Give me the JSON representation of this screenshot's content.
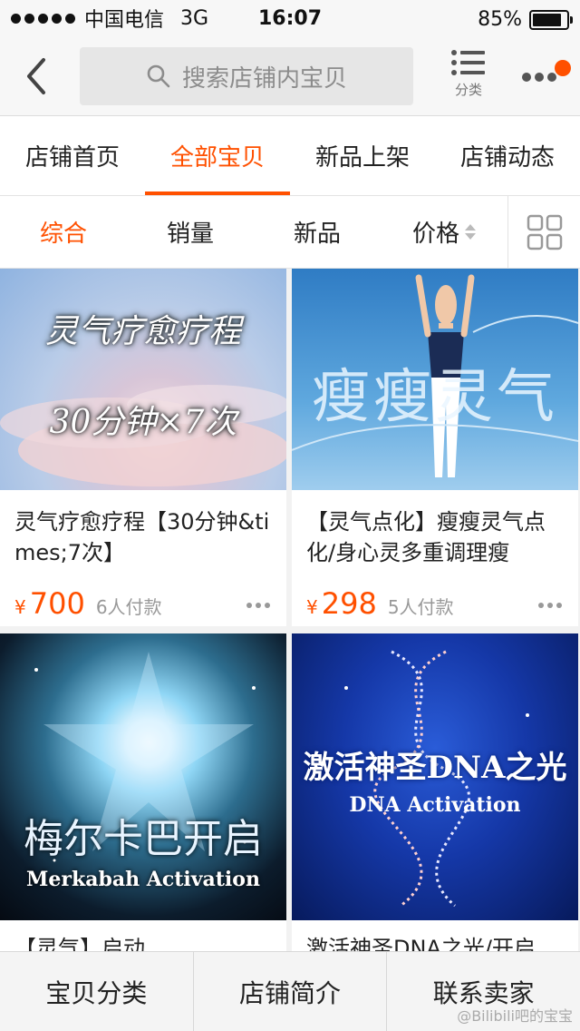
{
  "status_bar": {
    "carrier": "中国电信",
    "network": "3G",
    "time": "16:07",
    "battery_text": "85%",
    "battery_level": 0.85
  },
  "nav": {
    "back_icon": "chevron-left-icon",
    "search_placeholder": "搜索店铺内宝贝",
    "category_label": "分类",
    "notification_color": "#ff5000"
  },
  "store_tabs": [
    {
      "label": "店铺首页",
      "active": false
    },
    {
      "label": "全部宝贝",
      "active": true
    },
    {
      "label": "新品上架",
      "active": false
    },
    {
      "label": "店铺动态",
      "active": false
    }
  ],
  "sort_bar": {
    "items": [
      "综合",
      "销量",
      "新品",
      "价格"
    ],
    "active": "综合"
  },
  "products": [
    {
      "title": "灵气疗愈疗程【30分钟&times;7次】",
      "currency": "¥",
      "price": "700",
      "sold": "6人付款",
      "image_text": [
        "灵气疗愈疗程",
        "30分钟×7次"
      ]
    },
    {
      "title": "【灵气点化】瘦瘦灵气点化/身心灵多重调理瘦",
      "currency": "¥",
      "price": "298",
      "sold": "5人付款",
      "image_text": [
        "瘦瘦灵气"
      ]
    },
    {
      "title": "【灵气】启动",
      "image_text": [
        "梅尔卡巴开启",
        "Merkabah Activation"
      ]
    },
    {
      "title": "激活神圣DNA之光/开启",
      "image_text": [
        "激活神圣DNA之光",
        "DNA Activation"
      ]
    }
  ],
  "bottom_bar": [
    "宝贝分类",
    "店铺简介",
    "联系卖家"
  ],
  "watermark": "@Bilibili吧的宝宝",
  "colors": {
    "accent": "#ff5000"
  }
}
